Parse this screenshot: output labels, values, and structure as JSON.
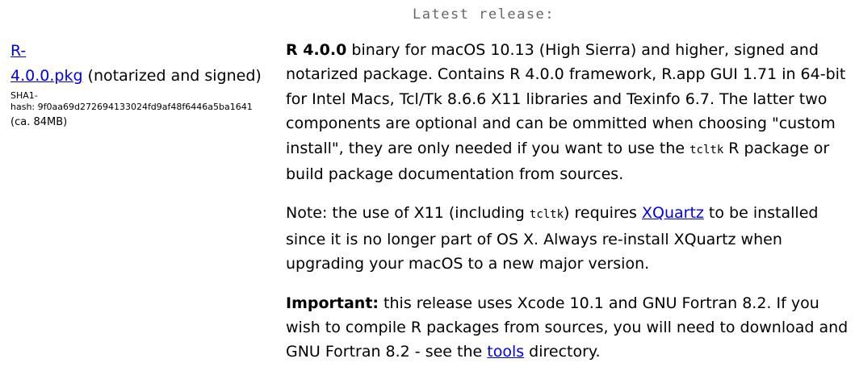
{
  "heading": "Latest release:",
  "package": {
    "link_line1": "R-",
    "link_line2": "4.0.0.pkg",
    "note": " (notarized and signed)",
    "hash_label": "SHA1-",
    "hash_prefix": "hash: ",
    "hash_value": "9f0aa69d272694133024fd9af48f6446a5ba1641",
    "size": "(ca. 84MB)"
  },
  "description": {
    "bold": "R 4.0.0",
    "text": " binary for macOS 10.13 (High Sierra) and higher, signed and notarized package. Contains R 4.0.0 framework, R.app GUI 1.71 in 64-bit for Intel Macs, Tcl/Tk 8.6.6 X11 libraries and Texinfo 6.7. The latter two components are optional and can be ommitted when choosing \"custom install\", they are only needed if you want to use the ",
    "code": "tcltk",
    "text_end": " R package or build package documentation from sources."
  },
  "note": {
    "prefix": "Note: the use of X11 (including ",
    "code": "tcltk",
    "middle": ") requires ",
    "link": "XQuartz",
    "suffix": " to be installed since it is no longer part of OS X. Always re-install XQuartz when upgrading your macOS to a new major version."
  },
  "important": {
    "bold": "Important:",
    "text": " this release uses Xcode 10.1 and GNU Fortran 8.2. If you wish to compile R packages from sources, you will need to download and GNU Fortran 8.2 - see the ",
    "link": "tools",
    "suffix": " directory."
  },
  "colors": {
    "link": "#0000ee",
    "heading": "#666666"
  }
}
